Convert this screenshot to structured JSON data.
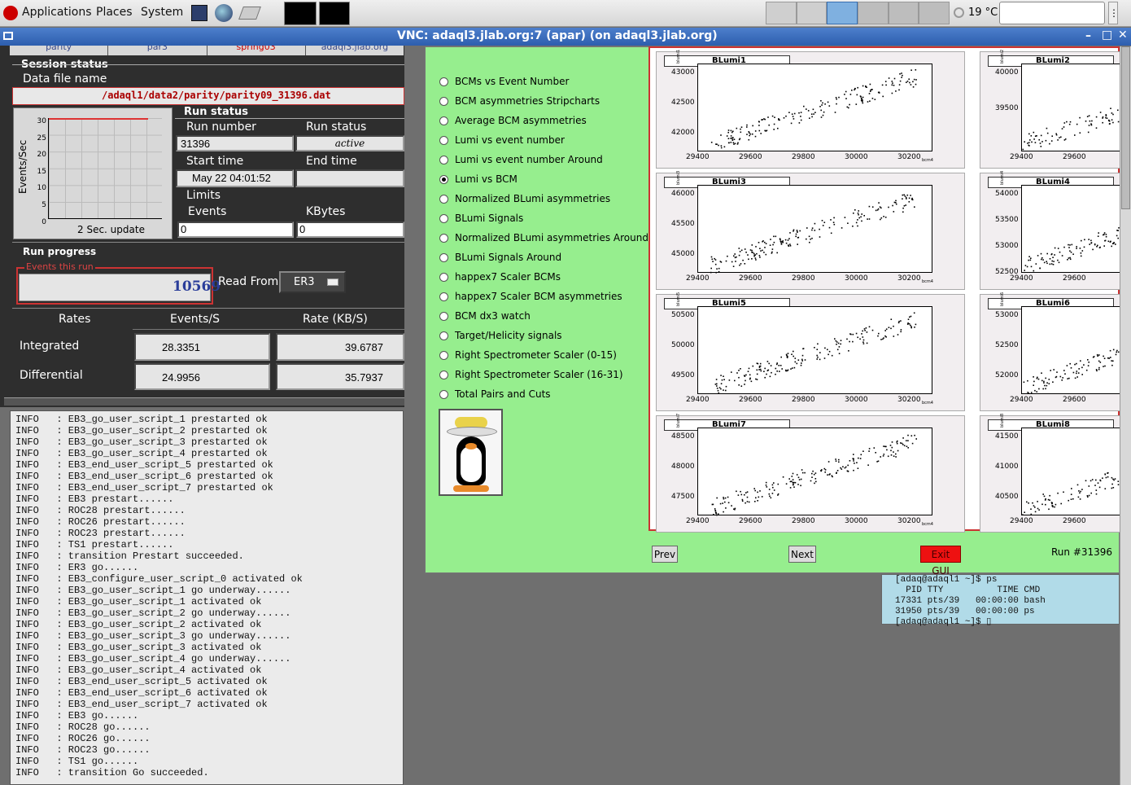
{
  "taskbar": {
    "applications": "Applications",
    "places": "Places",
    "system": "System",
    "temperature": "19 °C"
  },
  "vnc": {
    "title": "VNC: adaql3.jlab.org:7 (apar) (on adaql3.jlab.org)"
  },
  "top_tabs": [
    "parity",
    "par3",
    "spring03",
    "adaql3.jlab.org"
  ],
  "session": {
    "heading": "Session status",
    "data_file_label": "Data file name",
    "data_file": "/adaql1/data2/parity/parity09_31396.dat"
  },
  "rate_plot": {
    "ylabel": "Events/Sec",
    "yticks": [
      "30",
      "25",
      "20",
      "15",
      "10",
      "5",
      "0"
    ],
    "caption": "2 Sec. update"
  },
  "run_status": {
    "heading": "Run status",
    "run_number_label": "Run number",
    "run_number": "31396",
    "run_status_label": "Run status",
    "run_status": "active",
    "start_time_label": "Start time",
    "start_time": "May 22 04:01:52",
    "end_time_label": "End time",
    "end_time": "",
    "limits_label": "Limits",
    "events_label": "Events",
    "events": "0",
    "kbytes_label": "KBytes",
    "kbytes": "0"
  },
  "run_progress": {
    "heading": "Run progress",
    "events_label": "Events this run",
    "events": "10569",
    "read_from_label": "Read From:",
    "read_from": "ER3"
  },
  "rates": {
    "col_rates": "Rates",
    "col_events": "Events/S",
    "col_kb": "Rate (KB/S)",
    "integrated_label": "Integrated",
    "integrated_events": "28.3351",
    "integrated_kb": "39.6787",
    "differential_label": "Differential",
    "differential_events": "24.9956",
    "differential_kb": "35.7937"
  },
  "log_lines": [
    "INFO   : EB3_go_user_script_1 prestarted ok",
    "INFO   : EB3_go_user_script_2 prestarted ok",
    "INFO   : EB3_go_user_script_3 prestarted ok",
    "INFO   : EB3_go_user_script_4 prestarted ok",
    "INFO   : EB3_end_user_script_5 prestarted ok",
    "INFO   : EB3_end_user_script_6 prestarted ok",
    "INFO   : EB3_end_user_script_7 prestarted ok",
    "INFO   : EB3 prestart......",
    "INFO   : ROC28 prestart......",
    "INFO   : ROC26 prestart......",
    "INFO   : ROC23 prestart......",
    "INFO   : TS1 prestart......",
    "INFO   : transition Prestart succeeded.",
    "INFO   : ER3 go......",
    "INFO   : EB3_configure_user_script_0 activated ok",
    "INFO   : EB3_go_user_script_1 go underway......",
    "INFO   : EB3_go_user_script_1 activated ok",
    "INFO   : EB3_go_user_script_2 go underway......",
    "INFO   : EB3_go_user_script_2 activated ok",
    "INFO   : EB3_go_user_script_3 go underway......",
    "INFO   : EB3_go_user_script_3 activated ok",
    "INFO   : EB3_go_user_script_4 go underway......",
    "INFO   : EB3_go_user_script_4 activated ok",
    "INFO   : EB3_end_user_script_5 activated ok",
    "INFO   : EB3_end_user_script_6 activated ok",
    "INFO   : EB3_end_user_script_7 activated ok",
    "INFO   : EB3 go......",
    "INFO   : ROC28 go......",
    "INFO   : ROC26 go......",
    "INFO   : ROC23 go......",
    "INFO   : TS1 go......",
    "INFO   : transition Go succeeded."
  ],
  "options": [
    {
      "label": "BCMs vs Event Number",
      "selected": false
    },
    {
      "label": "BCM asymmetries Stripcharts",
      "selected": false
    },
    {
      "label": "Average BCM asymmetries",
      "selected": false
    },
    {
      "label": "Lumi vs event number",
      "selected": false
    },
    {
      "label": "Lumi vs event number Around",
      "selected": false
    },
    {
      "label": "Lumi vs BCM",
      "selected": true
    },
    {
      "label": "Normalized BLumi asymmetries",
      "selected": false
    },
    {
      "label": "BLumi Signals",
      "selected": false
    },
    {
      "label": "Normalized BLumi asymmetries Around",
      "selected": false
    },
    {
      "label": "BLumi Signals Around",
      "selected": false
    },
    {
      "label": "happex7 Scaler BCMs",
      "selected": false
    },
    {
      "label": "happex7 Scaler BCM asymmetries",
      "selected": false
    },
    {
      "label": "BCM dx3 watch",
      "selected": false
    },
    {
      "label": "Target/Helicity signals",
      "selected": false
    },
    {
      "label": "Right Spectrometer Scaler (0-15)",
      "selected": false
    },
    {
      "label": "Right Spectrometer Scaler (16-31)",
      "selected": false
    },
    {
      "label": "Total Pairs and Cuts",
      "selected": false
    }
  ],
  "plots": [
    {
      "title": "BLumi1",
      "yticks": [
        "43000",
        "42500",
        "42000"
      ],
      "xticks": [
        "29400",
        "29600",
        "29800",
        "30000",
        "30200"
      ],
      "xunit": "bcm4",
      "yunit": "blumi1"
    },
    {
      "title": "BLumi2",
      "yticks": [
        "40000",
        "39500"
      ],
      "xticks": [
        "29400",
        "29600"
      ],
      "yunit": "blumi2"
    },
    {
      "title": "BLumi3",
      "yticks": [
        "46000",
        "45500",
        "45000"
      ],
      "xticks": [
        "29400",
        "29600",
        "29800",
        "30000",
        "30200"
      ],
      "xunit": "bcm4",
      "yunit": "blumi3"
    },
    {
      "title": "BLumi4",
      "yticks": [
        "54000",
        "53500",
        "53000",
        "52500"
      ],
      "xticks": [
        "29400",
        "29600"
      ],
      "yunit": "blumi4"
    },
    {
      "title": "BLumi5",
      "yticks": [
        "50500",
        "50000",
        "49500"
      ],
      "xticks": [
        "29400",
        "29600",
        "29800",
        "30000",
        "30200"
      ],
      "xunit": "bcm4",
      "yunit": "blumi5"
    },
    {
      "title": "BLumi6",
      "yticks": [
        "53000",
        "52500",
        "52000"
      ],
      "xticks": [
        "29400",
        "29600"
      ],
      "yunit": "blumi6"
    },
    {
      "title": "BLumi7",
      "yticks": [
        "48500",
        "48000",
        "47500"
      ],
      "xticks": [
        "29400",
        "29600",
        "29800",
        "30000",
        "30200"
      ],
      "xunit": "bcm4",
      "yunit": "blumi7"
    },
    {
      "title": "BLumi8",
      "yticks": [
        "41500",
        "41000",
        "40500"
      ],
      "xticks": [
        "29400",
        "29600"
      ],
      "yunit": "blumi8"
    }
  ],
  "buttons": {
    "prev": "Prev",
    "next": "Next",
    "exit": "Exit GUI"
  },
  "run_label": "Run #31396",
  "terminal": [
    "[adaq@adaql1 ~]$ ps",
    "  PID TTY          TIME CMD",
    "17331 pts/39   00:00:00 bash",
    "31950 pts/39   00:00:00 ps",
    "[adaq@adaql1 ~]$ ▯"
  ]
}
